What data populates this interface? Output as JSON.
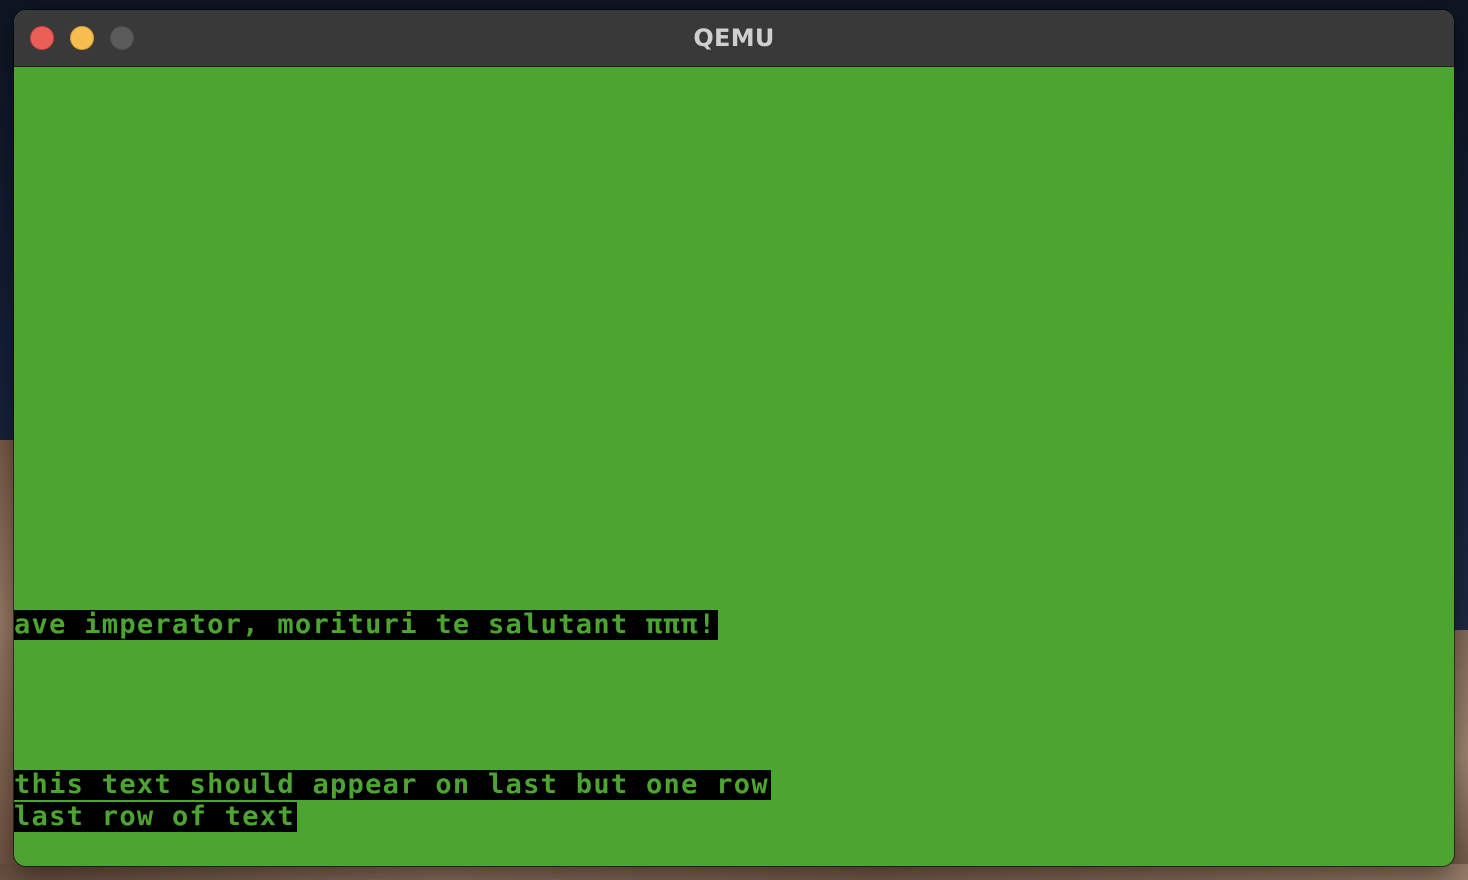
{
  "window": {
    "title": "QEMU",
    "controls": {
      "close": "close-icon",
      "minimize": "minimize-icon",
      "zoom": "zoom-icon"
    }
  },
  "screen": {
    "background_color": "#4ba530",
    "text_color": "#4ba530",
    "text_background": "#000000",
    "lines": [
      "ave imperator, morituri te salutant πππ!",
      "this text should appear on last but one row",
      "last row of text"
    ]
  }
}
